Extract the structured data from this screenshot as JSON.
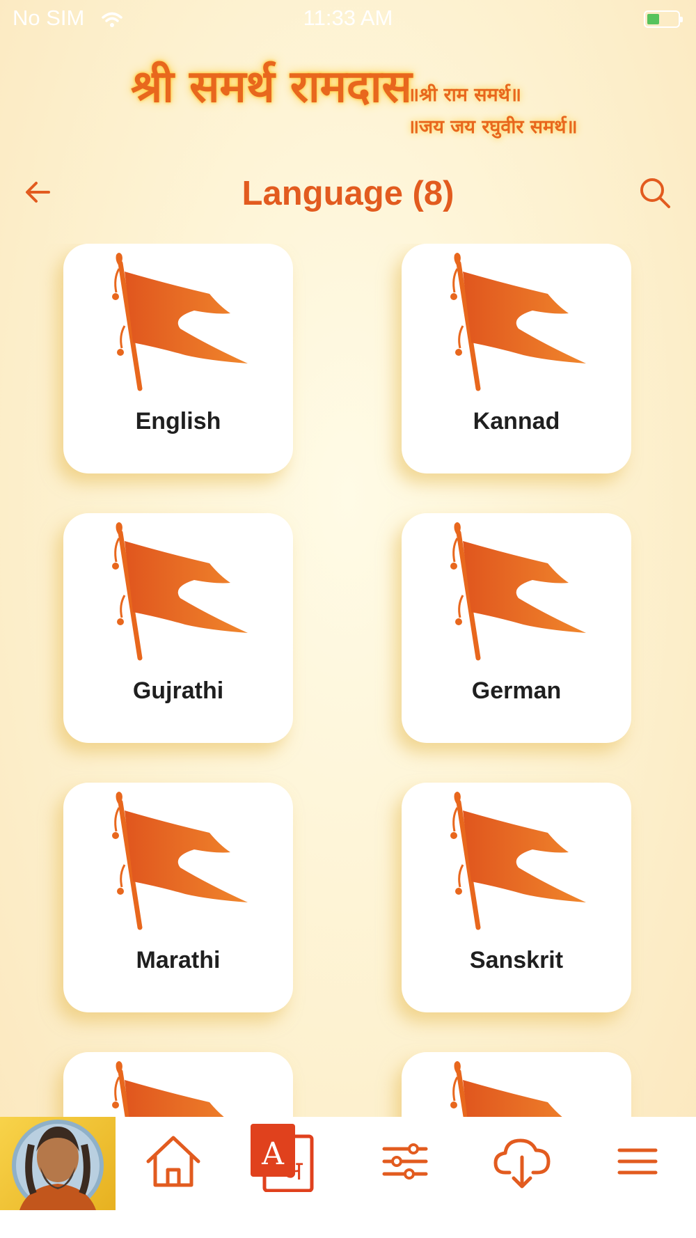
{
  "status_bar": {
    "carrier": "No SIM",
    "time": "11:33 AM"
  },
  "banner": {
    "title": "श्री समर्थ रामदास",
    "line1": "॥श्री राम समर्थ॥",
    "line2": "॥जय जय रघुवीर समर्थ॥"
  },
  "header": {
    "title": "Language (8)"
  },
  "languages": [
    {
      "label": "English"
    },
    {
      "label": "Kannad"
    },
    {
      "label": "Gujrathi"
    },
    {
      "label": "German"
    },
    {
      "label": "Marathi"
    },
    {
      "label": "Sanskrit"
    },
    {
      "label": ""
    },
    {
      "label": ""
    }
  ],
  "colors": {
    "accent": "#e25b1f",
    "flag": "#e8671d",
    "background": "#fdf1cf"
  },
  "icons": [
    "back-arrow-icon",
    "search-icon",
    "flag-icon",
    "home-icon",
    "translate-icon",
    "sliders-icon",
    "cloud-download-icon",
    "hamburger-menu-icon"
  ]
}
